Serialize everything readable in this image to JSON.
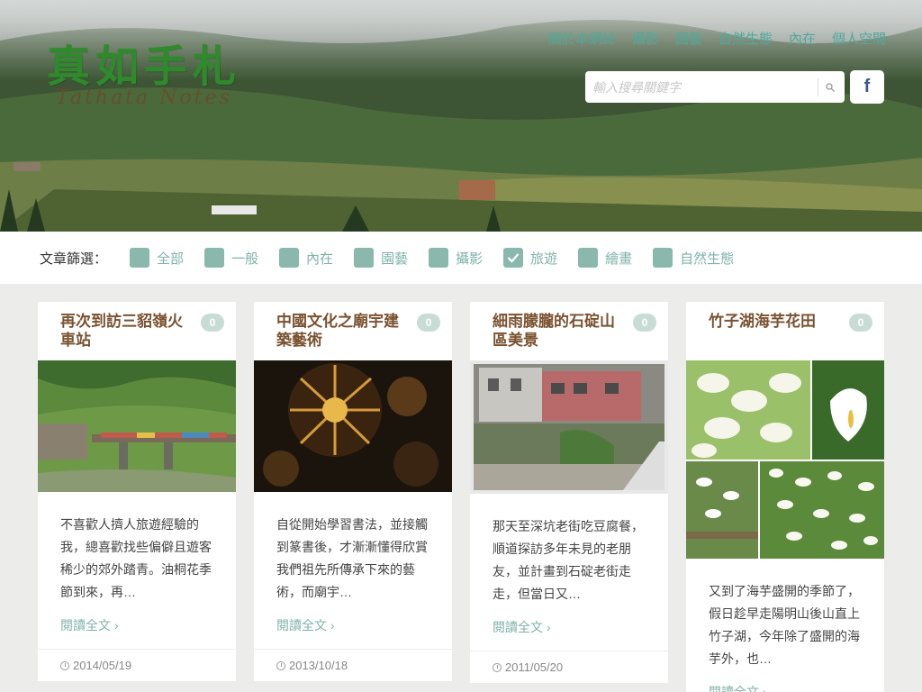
{
  "header": {
    "logo_title": "真如手札",
    "logo_subtitle": "Tathata Notes",
    "nav": [
      "關於本網誌",
      "攝影",
      "園藝",
      "自然生態",
      "內在",
      "個人空間"
    ],
    "search_placeholder": "輸入搜尋關鍵字",
    "facebook_label": "f"
  },
  "filter": {
    "label": "文章篩選：",
    "items": [
      {
        "label": "全部",
        "checked": false
      },
      {
        "label": "一般",
        "checked": false
      },
      {
        "label": "內在",
        "checked": false
      },
      {
        "label": "園藝",
        "checked": false
      },
      {
        "label": "攝影",
        "checked": false
      },
      {
        "label": "旅遊",
        "checked": true
      },
      {
        "label": "繪畫",
        "checked": false
      },
      {
        "label": "自然生態",
        "checked": false
      }
    ]
  },
  "cards": [
    {
      "title": "再次到訪三貂嶺火車站",
      "comments": "0",
      "excerpt": "不喜歡人擠人旅遊經驗的我，總喜歡找些偏僻且遊客稀少的郊外踏青。油桐花季節到來，再…",
      "read_more": "閱讀全文 ›",
      "date": "2014/05/19"
    },
    {
      "title": "中國文化之廟宇建築藝術",
      "comments": "0",
      "excerpt": "自從開始學習書法，並接觸到篆書後，才漸漸懂得欣賞我們祖先所傳承下來的藝術，而廟宇…",
      "read_more": "閱讀全文 ›",
      "date": "2013/10/18"
    },
    {
      "title": "細雨朦朧的石碇山區美景",
      "comments": "0",
      "excerpt": "那天至深坑老街吃豆腐餐，順道探訪多年未見的老朋友，並計畫到石碇老街走走，但當日又…",
      "read_more": "閱讀全文 ›",
      "date": "2011/05/20"
    },
    {
      "title": "竹子湖海芋花田",
      "comments": "0",
      "excerpt": "又到了海芋盛開的季節了，假日趁早走陽明山後山直上竹子湖，今年除了盛開的海芋外，也…",
      "read_more": "閱讀全文 ›",
      "date": ""
    }
  ],
  "colors": {
    "accent": "#7fb3a9",
    "title_brown": "#7a5230",
    "checkbox": "#8ab8ad"
  }
}
